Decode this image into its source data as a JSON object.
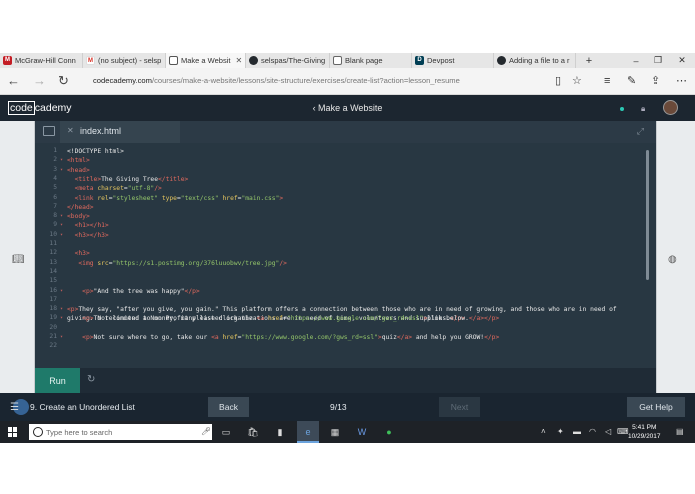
{
  "browser": {
    "tabs": [
      {
        "title": "McGraw-Hill Conn",
        "color": "#c41d25",
        "glyph": "M",
        "icon": "mcgraw-hill-icon"
      },
      {
        "title": "(no subject) - selsp",
        "color": "#d93025",
        "glyph": "M",
        "icon": "gmail-icon"
      },
      {
        "title": "Make a Websit",
        "color": "#333333",
        "glyph": "",
        "icon": "page-icon",
        "active": true
      },
      {
        "title": "selspas/The-Giving",
        "color": "#24292e",
        "glyph": "",
        "icon": "github-icon"
      },
      {
        "title": "Blank page",
        "color": "#666666",
        "glyph": "",
        "icon": "page-icon"
      },
      {
        "title": "Devpost",
        "color": "#003e54",
        "glyph": "D",
        "icon": "devpost-icon"
      },
      {
        "title": "Adding a file to a r",
        "color": "#24292e",
        "glyph": "",
        "icon": "github-icon"
      }
    ],
    "url_domain": "codecademy.com",
    "url_path": "/courses/make-a-website/lessons/site-structure/exercises/create-list?action=lesson_resume"
  },
  "codecademy": {
    "logo_left": "code",
    "logo_right": "cademy",
    "course_title": "‹ Make a Website"
  },
  "editor": {
    "filename": "index.html",
    "lines": [
      {
        "n": "1",
        "fold": false,
        "html": "<span class=\"d\">&lt;!DOCTYPE html&gt;</span>"
      },
      {
        "n": "2",
        "fold": true,
        "html": "<span class=\"t\">&lt;html&gt;</span>"
      },
      {
        "n": "3",
        "fold": true,
        "html": "<span class=\"t\">&lt;head&gt;</span>"
      },
      {
        "n": "4",
        "fold": false,
        "html": "  <span class=\"t\">&lt;title&gt;</span>The Giving Tree<span class=\"t\">&lt;/title&gt;</span>"
      },
      {
        "n": "5",
        "fold": false,
        "html": "  <span class=\"t\">&lt;meta </span><span class=\"a\">charset</span>=<span class=\"s\">\"utf-8\"</span><span class=\"t\">/&gt;</span>"
      },
      {
        "n": "6",
        "fold": false,
        "html": "  <span class=\"t\">&lt;link </span><span class=\"a\">rel</span>=<span class=\"s\">\"stylesheet\"</span> <span class=\"a\">type</span>=<span class=\"s\">\"text/css\"</span> <span class=\"a\">href</span>=<span class=\"s\">\"main.css\"</span><span class=\"t\">&gt;</span>"
      },
      {
        "n": "7",
        "fold": false,
        "html": "<span class=\"t\">&lt;/head&gt;</span>"
      },
      {
        "n": "8",
        "fold": true,
        "html": "<span class=\"t\">&lt;body&gt;</span>"
      },
      {
        "n": "9",
        "fold": true,
        "html": "  <span class=\"t\">&lt;h1&gt;&lt;/h1&gt;</span>"
      },
      {
        "n": "10",
        "fold": true,
        "html": "  <span class=\"t\">&lt;h3&gt;&lt;/h3&gt;</span>"
      },
      {
        "n": "11",
        "fold": false,
        "html": ""
      },
      {
        "n": "12",
        "fold": false,
        "html": "  <span class=\"t\">&lt;h3&gt;</span>"
      },
      {
        "n": "13",
        "fold": false,
        "html": "   <span class=\"t\">&lt;img </span><span class=\"a\">src</span>=<span class=\"s\">\"https://s1.postimg.org/376luuobwv/tree.jpg\"</span><span class=\"t\">/&gt;</span>"
      },
      {
        "n": "14",
        "fold": false,
        "html": ""
      },
      {
        "n": "15",
        "fold": false,
        "html": ""
      },
      {
        "n": "16",
        "fold": true,
        "html": "    <span class=\"t\">&lt;p&gt;</span>\"And the tree was happy\"<span class=\"t\">&lt;/p&gt;</span>"
      },
      {
        "n": "17",
        "fold": false,
        "html": ""
      },
      {
        "n": "18",
        "fold": true,
        "html": "<span class=\"t\">&lt;p&gt;</span>They say, \"after you give, you gain.\" This platform offers a connection between those who are in need of growing, and those who are in need of giving. Not limited to money, many listed organizations are in need of time, volunteers and supplies.<span class=\"t\">&lt;/p&gt;</span>"
      },
      {
        "n": "19",
        "fold": true,
        "html": "    <span class=\"t\">&lt;p&gt;</span>To recommend a Non Profit please click the <span class=\"t\">&lt;a </span><span class=\"a\">href</span>=<span class=\"s\">\"https://www.google.com/?gws_rd=ssl\"</span><span class=\"t\">&gt;</span>link below.<span class=\"t\">&lt;/a&gt;&lt;/p&gt;</span>"
      },
      {
        "n": "20",
        "fold": false,
        "html": ""
      },
      {
        "n": "21",
        "fold": true,
        "html": "    <span class=\"t\">&lt;p&gt;</span>Not sure where to go, take our <span class=\"t\">&lt;a </span><span class=\"a\">href</span>=<span class=\"s\">\"https://www.google.com/?gws_rd=ssl\"</span><span class=\"t\">&gt;</span>quiz<span class=\"t\">&lt;/a&gt;</span> and help you GROW!<span class=\"t\">&lt;/p&gt;</span>"
      },
      {
        "n": "22",
        "fold": false,
        "html": ""
      }
    ]
  },
  "run_label": "Run",
  "bottom": {
    "lesson": "9. Create an Unordered List",
    "back": "Back",
    "progress": "9/13",
    "next": "Next",
    "help": "Get Help"
  },
  "taskbar": {
    "search_placeholder": "Type here to search",
    "time": "5:41 PM",
    "date": "10/29/2017"
  }
}
